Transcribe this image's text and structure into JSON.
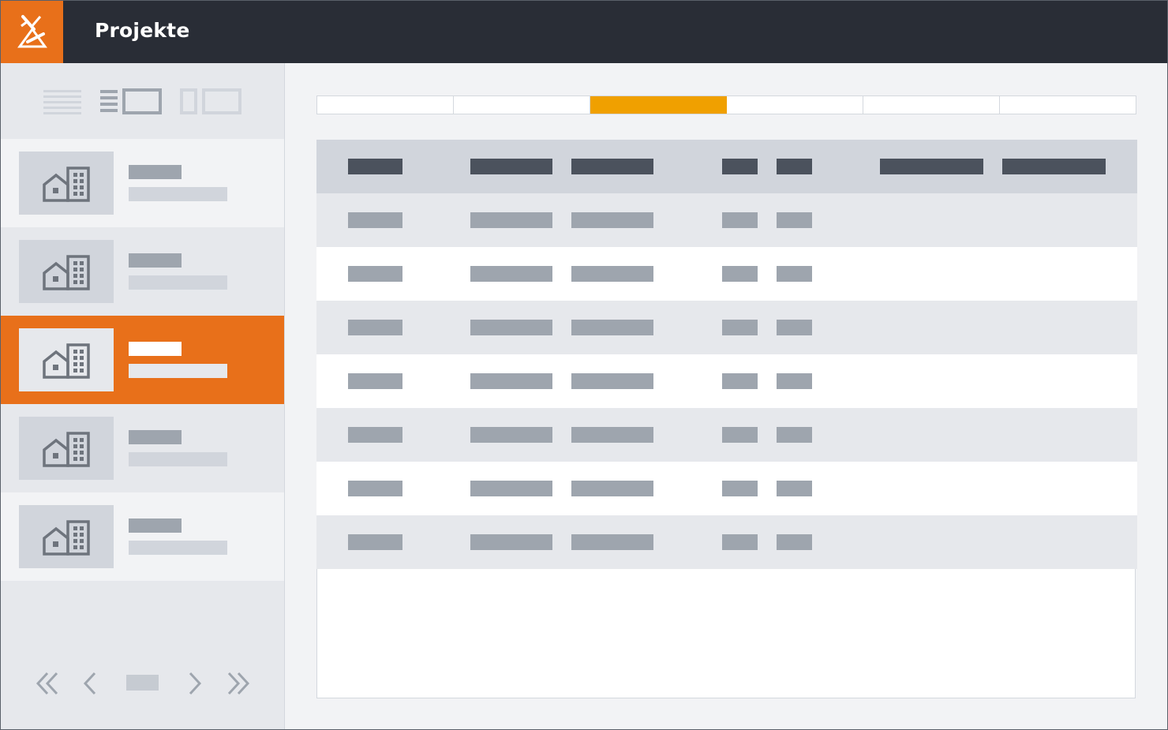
{
  "app": {
    "title": "Projekte",
    "logo_icon": "building-tools-logo-icon",
    "colors": {
      "header": "#292d36",
      "logo_bg": "#e8701a",
      "active_item": "#e8701a",
      "active_tab": "#f0a000"
    }
  },
  "sidebar": {
    "view_modes": [
      {
        "name": "list-view-icon",
        "selected": false
      },
      {
        "name": "detail-list-view-icon",
        "selected": true
      },
      {
        "name": "tile-view-icon",
        "selected": false
      }
    ],
    "items": [
      {
        "icon": "house-building-icon",
        "active": false
      },
      {
        "icon": "house-building-icon",
        "active": false
      },
      {
        "icon": "house-building-icon",
        "active": true
      },
      {
        "icon": "house-building-icon",
        "active": false
      },
      {
        "icon": "house-building-icon",
        "active": false
      }
    ],
    "pager": {
      "icons": [
        "first-page-icon",
        "previous-page-icon",
        "next-page-icon",
        "last-page-icon"
      ]
    }
  },
  "main": {
    "tab_count": 6,
    "active_tab_index": 2,
    "table": {
      "column_count": 7,
      "row_count": 7
    }
  }
}
